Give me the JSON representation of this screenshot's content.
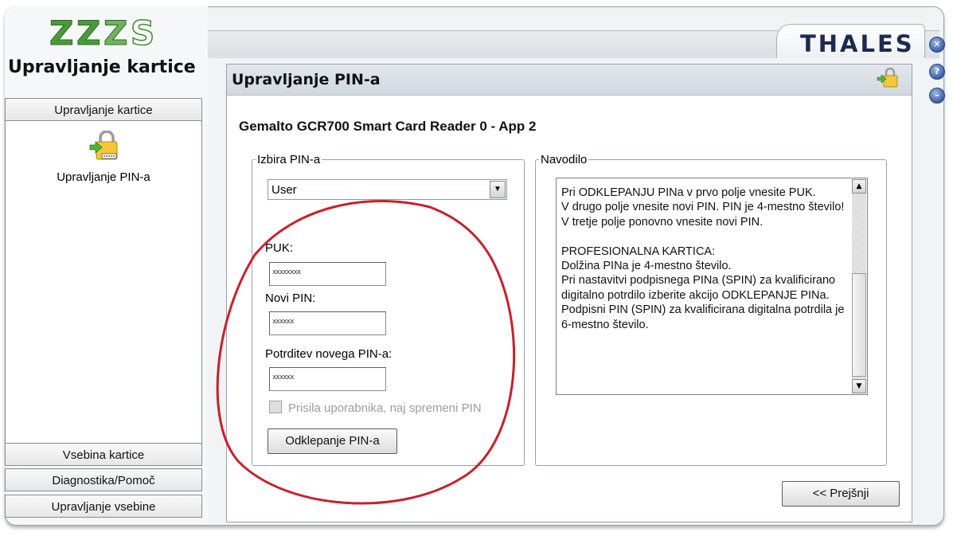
{
  "window": {
    "brand": "THALES",
    "controls": [
      {
        "name": "close",
        "glyph": "✕"
      },
      {
        "name": "help",
        "glyph": "?"
      },
      {
        "name": "minimize",
        "glyph": "–"
      }
    ]
  },
  "sidebar": {
    "logo_text": "ZZZS",
    "app_title": "Upravljanje kartice",
    "top_section": "Upravljanje kartice",
    "active_item": {
      "label": "Upravljanje PIN-a",
      "icon": "key-lock-icon"
    },
    "bottom_sections": [
      "Vsebina kartice",
      "Diagnostika/Pomoč",
      "Upravljanje vsebine"
    ]
  },
  "main": {
    "title": "Upravljanje PIN-a",
    "reader": "Gemalto GCR700 Smart Card Reader 0 - App 2",
    "pin_selection": {
      "legend": "Izbira PIN-a",
      "selected": "User",
      "puk_label": "PUK:",
      "puk_value": "xxxxxxxx",
      "new_pin_label": "Novi PIN:",
      "new_pin_value": "xxxxxx",
      "confirm_label": "Potrditev novega PIN-a:",
      "confirm_value": "xxxxxx",
      "force_change_label": "Prisila uporabnika, naj spremeni PIN",
      "unlock_button": "Odklepanje PIN-a"
    },
    "instructions": {
      "legend": "Navodilo",
      "text": "Pri ODKLEPANJU PINa v prvo polje vnesite PUK.\nV drugo polje vnesite novi PIN. PIN je 4-mestno število!\nV tretje polje ponovno vnesite novi PIN.\n\nPROFESIONALNA KARTICA:\nDolžina PINa je 4-mestno število.\nPri nastavitvi podpisnega PINa (SPIN) za kvalificirano digitalno potrdilo izberite akcijo ODKLEPANJE PINa.\nPodpisni PIN (SPIN) za kvalificirana digitalna potrdila je 6-mestno število."
    },
    "back_button": "<< Prejšnji"
  },
  "colors": {
    "annotation_circle": "#c8202a",
    "brand": "#1c2c4e",
    "logo_green": "#4a9a3a"
  }
}
